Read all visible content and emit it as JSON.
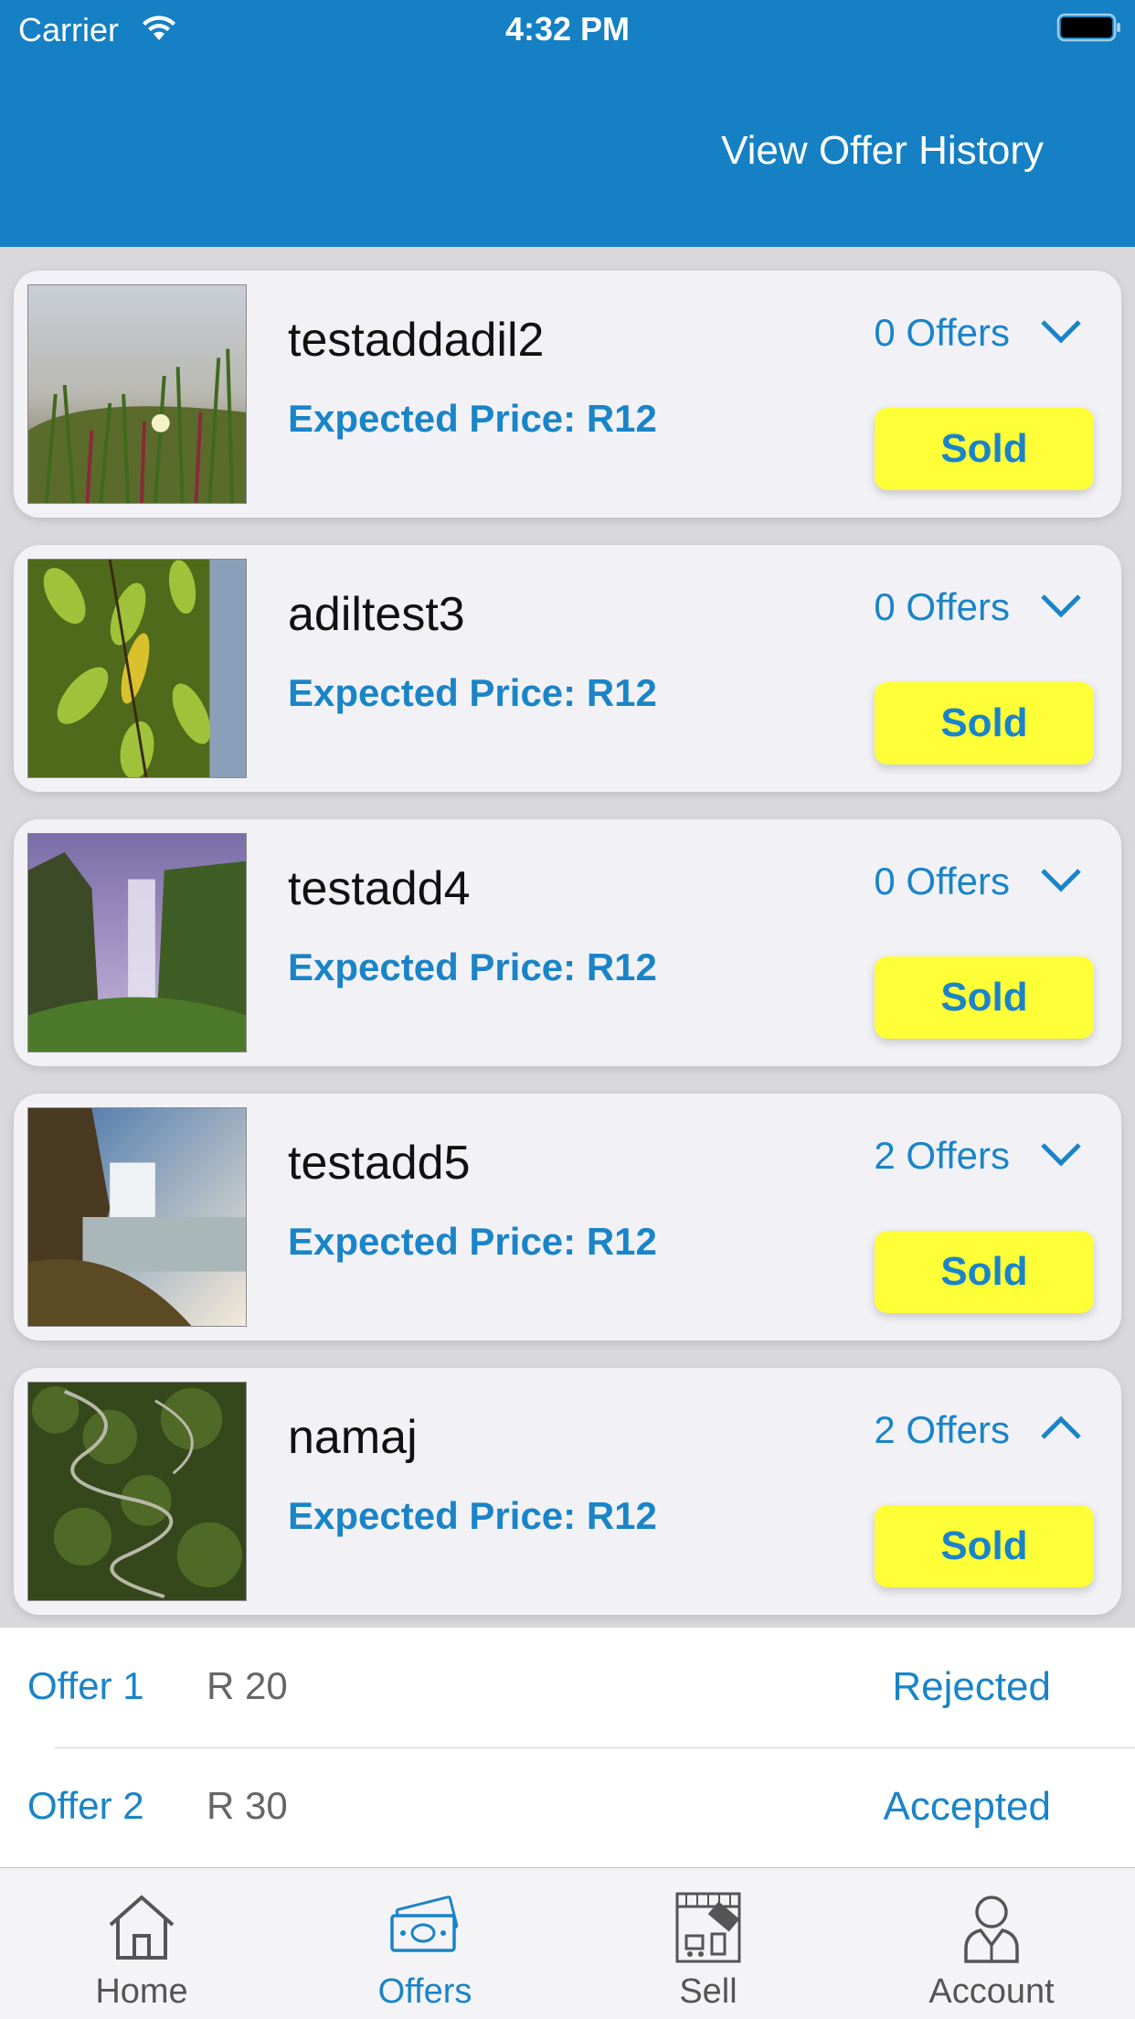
{
  "status_bar": {
    "carrier": "Carrier",
    "time": "4:32 PM"
  },
  "header": {
    "view_history": "View Offer History"
  },
  "listings": [
    {
      "title": "testaddadil2",
      "price": "Expected Price: R12",
      "offers": "0 Offers",
      "expanded": false,
      "sold_label": "Sold",
      "image": "grass-flower"
    },
    {
      "title": "adiltest3",
      "price": "Expected Price: R12",
      "offers": "0 Offers",
      "expanded": false,
      "sold_label": "Sold",
      "image": "green-leaves"
    },
    {
      "title": "testadd4",
      "price": "Expected Price: R12",
      "offers": "0 Offers",
      "expanded": false,
      "sold_label": "Sold",
      "image": "waterfall-cliff"
    },
    {
      "title": "testadd5",
      "price": "Expected Price: R12",
      "offers": "2 Offers",
      "expanded": false,
      "sold_label": "Sold",
      "image": "waterfall-sea"
    },
    {
      "title": "namaj",
      "price": "Expected Price: R12",
      "offers": "2 Offers",
      "expanded": true,
      "sold_label": "Sold",
      "image": "winding-road"
    }
  ],
  "offer_rows": [
    {
      "label": "Offer 1",
      "amount": "R 20",
      "status": "Rejected"
    },
    {
      "label": "Offer 2",
      "amount": "R 30",
      "status": "Accepted"
    }
  ],
  "tabs": [
    {
      "label": "Home",
      "icon": "home-icon",
      "active": false
    },
    {
      "label": "Offers",
      "icon": "money-icon",
      "active": true
    },
    {
      "label": "Sell",
      "icon": "sale-shop-icon",
      "active": false
    },
    {
      "label": "Account",
      "icon": "user-icon",
      "active": false
    }
  ],
  "colors": {
    "header": "#1580c4",
    "accent": "#1a84c8",
    "sold_button": "#ffff38"
  }
}
